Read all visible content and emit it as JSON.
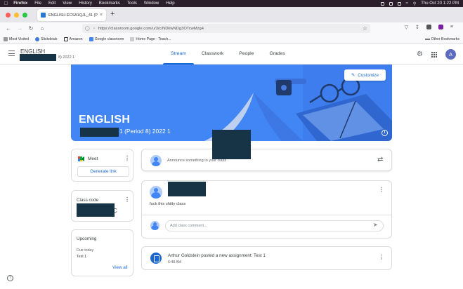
{
  "menubar": {
    "app": "Firefox",
    "items": [
      "File",
      "Edit",
      "View",
      "History",
      "Bookmarks",
      "Tools",
      "Window",
      "Help"
    ],
    "datetime": "Thu Oct 20  1:22 PM"
  },
  "browser": {
    "tab_title": "ENGLISH ECSA1QJL_41 (Period",
    "url": "https://classroom.google.com/u/3/c/NDkwNDg3OTcwMzg4",
    "bookmarks": [
      "Most Visited",
      "Slickdeals",
      "Amazon",
      "Google classroom",
      "Home Page - Teach..."
    ],
    "other_bookmarks": "Other Bookmarks"
  },
  "classroom": {
    "class_name": "ENGLISH",
    "class_subtitle": "8) 2022 1",
    "tabs": [
      "Stream",
      "Classwork",
      "People",
      "Grades"
    ],
    "active_tab": "Stream",
    "avatar_letter": "A"
  },
  "banner": {
    "title": "ENGLISH",
    "subtitle": "1 (Period 8) 2022 1",
    "customize_label": "Customize",
    "color": "#4285f4"
  },
  "meet": {
    "label": "Meet",
    "button": "Generate link"
  },
  "class_code": {
    "label": "Class code",
    "visible_tail": "C"
  },
  "upcoming": {
    "title": "Upcoming",
    "due": "Due today",
    "item": "Test 1",
    "view_all": "View all"
  },
  "stream": {
    "announce_placeholder": "Announce something to your class",
    "post_text": "fuck this shitty class",
    "comment_placeholder": "Add class comment...",
    "assignment_title": "Arthur Goldstein posted a new assignment: Test 1",
    "assignment_time": "6:48 AM"
  },
  "colors": {
    "accent": "#1967d2",
    "redaction": "#173446"
  }
}
